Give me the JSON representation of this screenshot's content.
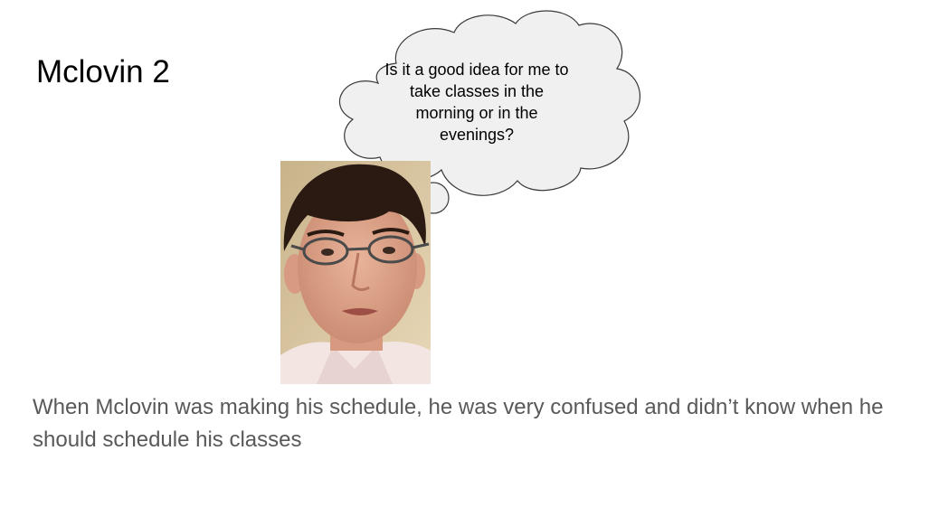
{
  "slide": {
    "title": "Mclovin 2",
    "thought_bubble": {
      "text": "Is it a good idea for me to take classes in the morning or in the evenings?"
    },
    "photo": {
      "subject": "portrait of young man with glasses",
      "icon": "person-photo"
    },
    "caption": "When Mclovin was making his schedule, he was very confused and didn’t know when he should schedule his classes"
  },
  "colors": {
    "background": "#ffffff",
    "title": "#000000",
    "caption": "#595959",
    "bubble_fill": "#f0f0f0",
    "bubble_stroke": "#3a3a3a"
  }
}
